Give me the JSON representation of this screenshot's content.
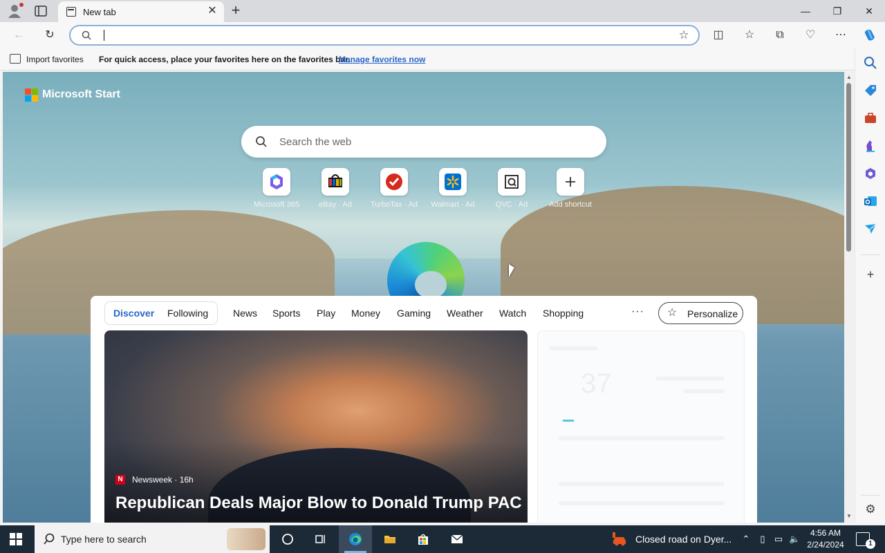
{
  "browser": {
    "tab_title": "New tab",
    "address_value": "",
    "favorites_bar": {
      "import_label": "Import favorites",
      "message": "For quick access, place your favorites here on the favorites bar.",
      "manage_link": "Manage favorites now"
    }
  },
  "newtab": {
    "brand": "Microsoft Start",
    "search_placeholder": "Search the web",
    "shortcuts": [
      {
        "label": "Microsoft 365",
        "icon": "microsoft-365-icon"
      },
      {
        "label": "eBay · Ad",
        "icon": "ebay-icon"
      },
      {
        "label": "TurboTax · Ad",
        "icon": "turbotax-icon"
      },
      {
        "label": "Walmart · Ad",
        "icon": "walmart-icon"
      },
      {
        "label": "QVC · Ad",
        "icon": "qvc-icon"
      },
      {
        "label": "Add shortcut",
        "icon": "plus-icon"
      }
    ],
    "feed_tabs": {
      "discover": "Discover",
      "following": "Following",
      "categories": [
        "News",
        "Sports",
        "Play",
        "Money",
        "Gaming",
        "Weather",
        "Watch",
        "Shopping"
      ]
    },
    "more_label": "···",
    "personalize_label": "Personalize",
    "hero": {
      "source": "Newsweek",
      "age": "16h",
      "source_badge": "N",
      "title": "Republican Deals Major Blow to Donald Trump PAC"
    },
    "weather_temp": "37"
  },
  "taskbar": {
    "search_placeholder": "Type here to search",
    "notification": "Closed road on Dyer...",
    "time": "4:56 AM",
    "date": "2/24/2024",
    "action_center_count": "1"
  },
  "colors": {
    "accent": "#2a66c9",
    "taskbar": "#1c2a38",
    "address_border": "#8ab0d8"
  }
}
